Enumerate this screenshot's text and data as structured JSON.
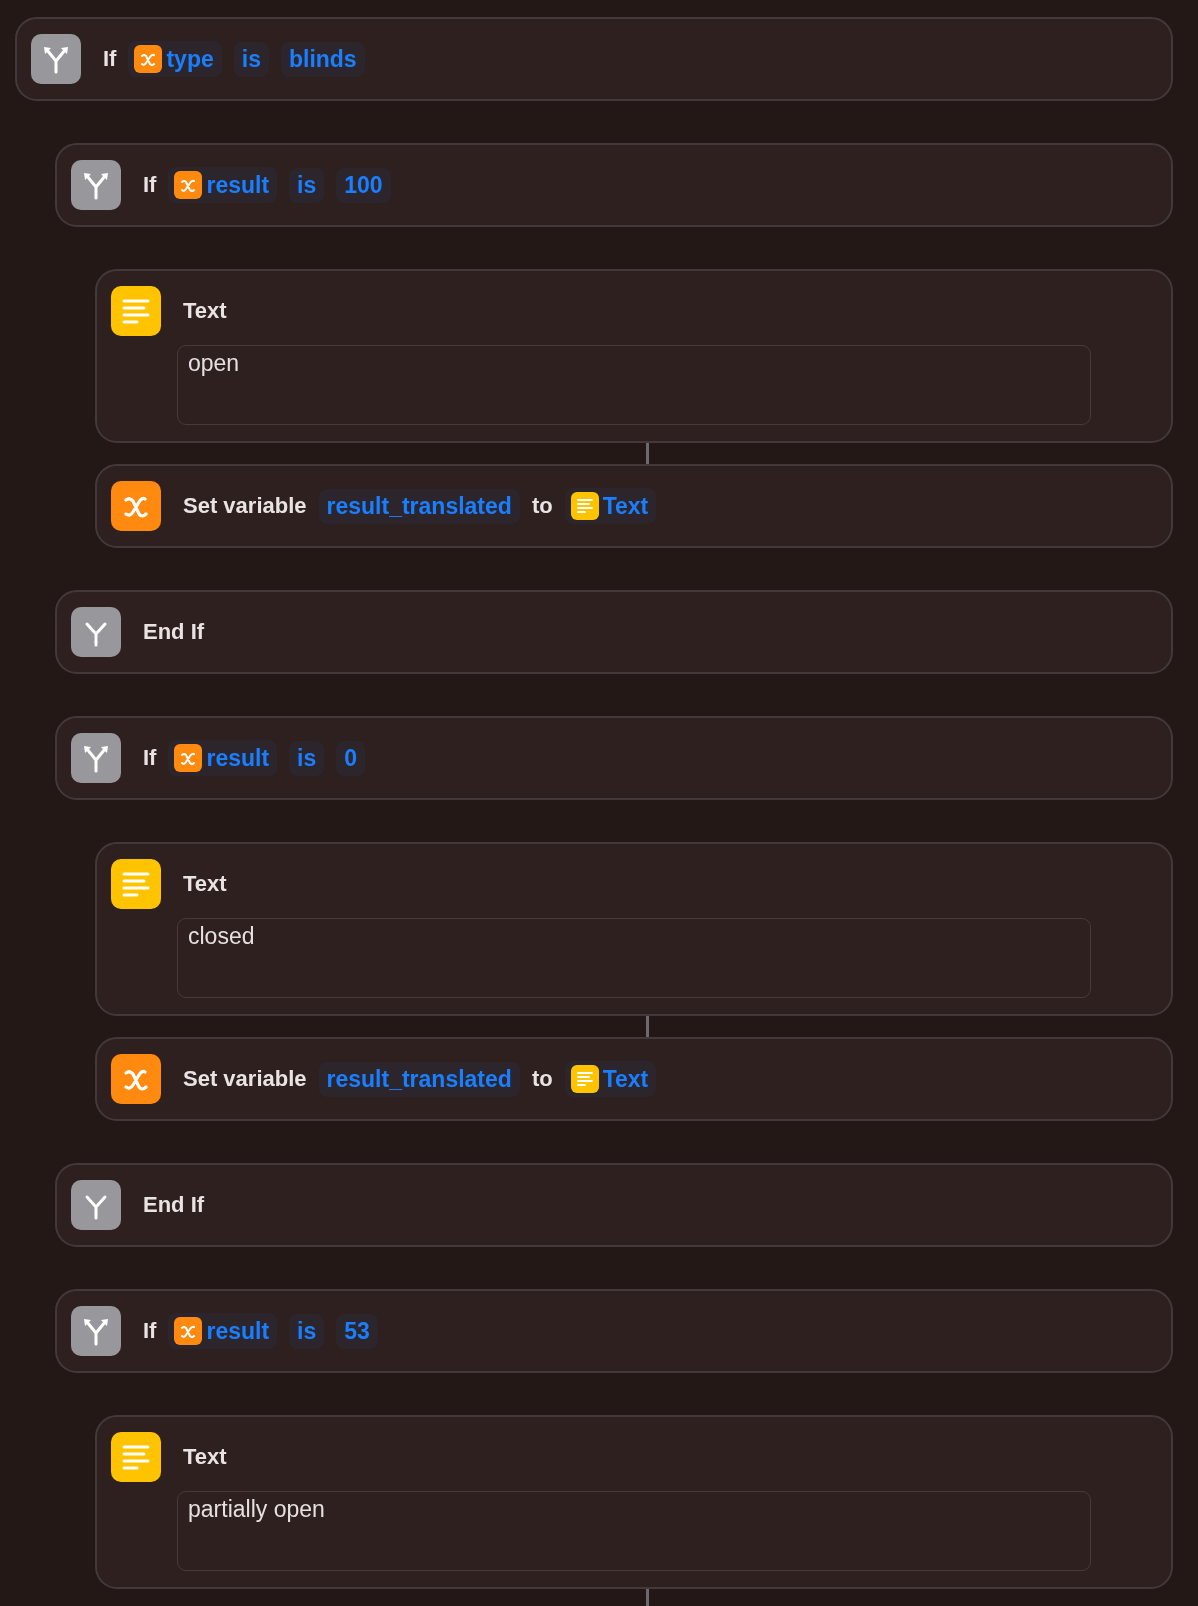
{
  "actions": [
    {
      "kind": "if",
      "parts": [
        {
          "kind": "word",
          "text": "If"
        },
        {
          "kind": "variable",
          "text": "type"
        },
        {
          "kind": "token",
          "text": "is"
        },
        {
          "kind": "token",
          "text": "blinds"
        }
      ],
      "children": [
        {
          "kind": "if",
          "parts": [
            {
              "kind": "word",
              "text": "If"
            },
            {
              "kind": "variable",
              "text": "result"
            },
            {
              "kind": "token",
              "text": "is"
            },
            {
              "kind": "token",
              "text": "100"
            }
          ],
          "children": [
            {
              "kind": "text",
              "parts": [
                {
                  "kind": "word",
                  "text": "Text"
                }
              ],
              "value": "open"
            },
            {
              "kind": "set",
              "parts": [
                {
                  "kind": "word",
                  "text": "Set variable"
                },
                {
                  "kind": "token",
                  "text": "result_translated"
                },
                {
                  "kind": "word",
                  "text": "to"
                },
                {
                  "kind": "text-ref",
                  "text": "Text"
                }
              ]
            }
          ]
        },
        {
          "kind": "endif",
          "parts": [
            {
              "kind": "word",
              "text": "End If"
            }
          ]
        },
        {
          "kind": "if",
          "parts": [
            {
              "kind": "word",
              "text": "If"
            },
            {
              "kind": "variable",
              "text": "result"
            },
            {
              "kind": "token",
              "text": "is"
            },
            {
              "kind": "token",
              "text": "0"
            }
          ],
          "children": [
            {
              "kind": "text",
              "parts": [
                {
                  "kind": "word",
                  "text": "Text"
                }
              ],
              "value": "closed"
            },
            {
              "kind": "set",
              "parts": [
                {
                  "kind": "word",
                  "text": "Set variable"
                },
                {
                  "kind": "token",
                  "text": "result_translated"
                },
                {
                  "kind": "word",
                  "text": "to"
                },
                {
                  "kind": "text-ref",
                  "text": "Text"
                }
              ]
            }
          ]
        },
        {
          "kind": "endif",
          "parts": [
            {
              "kind": "word",
              "text": "End If"
            }
          ]
        },
        {
          "kind": "if",
          "parts": [
            {
              "kind": "word",
              "text": "If"
            },
            {
              "kind": "variable",
              "text": "result"
            },
            {
              "kind": "token",
              "text": "is"
            },
            {
              "kind": "token",
              "text": "53"
            }
          ],
          "children": [
            {
              "kind": "text",
              "parts": [
                {
                  "kind": "word",
                  "text": "Text"
                }
              ],
              "value": "partially open"
            }
          ]
        }
      ]
    }
  ]
}
